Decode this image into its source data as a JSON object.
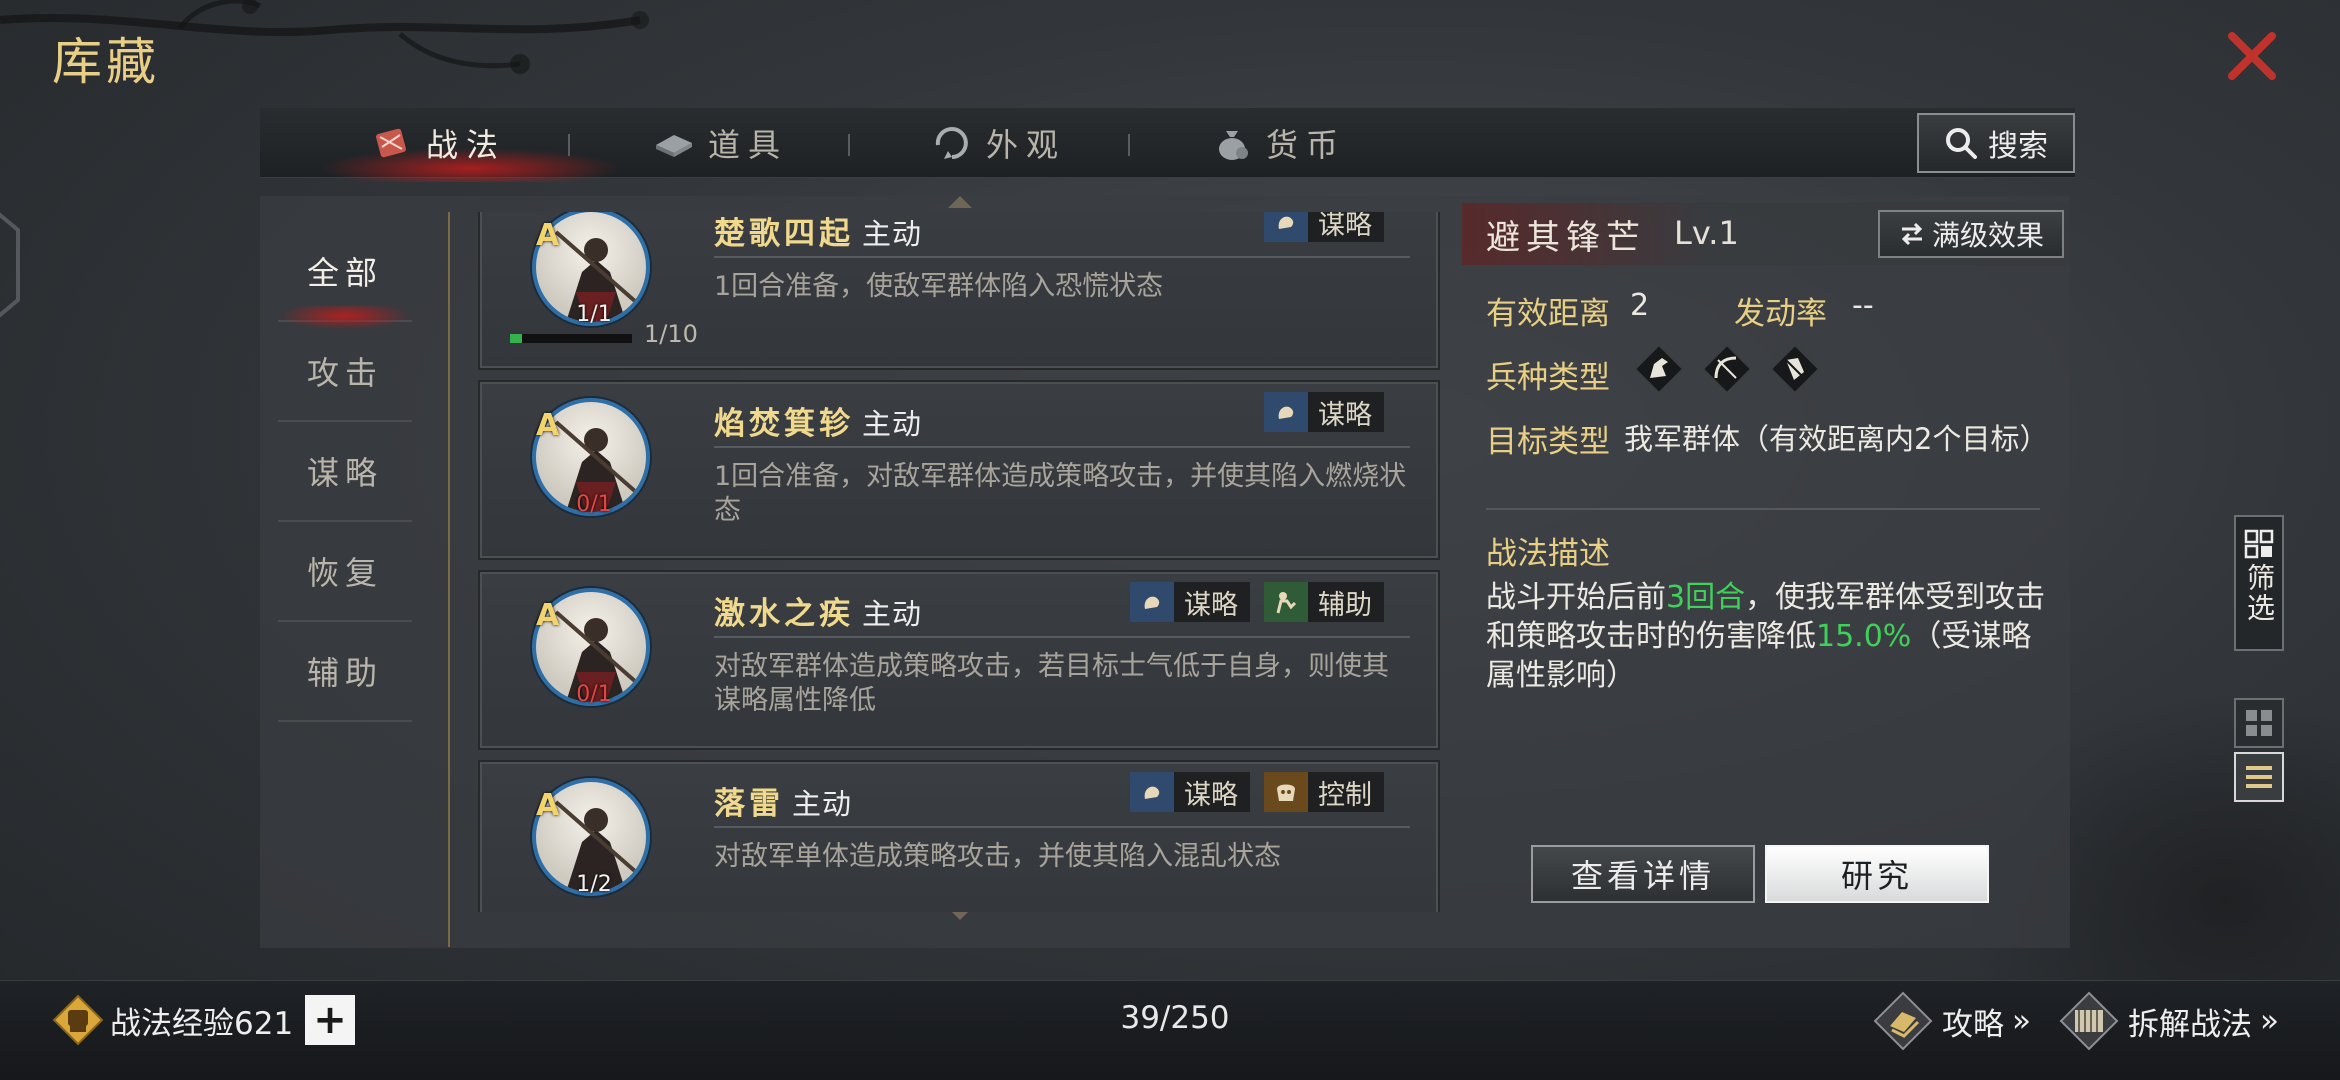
{
  "header": {
    "title": "库藏"
  },
  "tabs": [
    {
      "label": "战法",
      "icon": "scroll-icon",
      "active": true
    },
    {
      "label": "道具",
      "icon": "ingot-icon",
      "active": false
    },
    {
      "label": "外观",
      "icon": "swirl-icon",
      "active": false
    },
    {
      "label": "货币",
      "icon": "money-bag-icon",
      "active": false
    }
  ],
  "search": {
    "label": "搜索"
  },
  "categories": [
    {
      "label": "全部",
      "active": true
    },
    {
      "label": "攻击",
      "active": false
    },
    {
      "label": "谋略",
      "active": false
    },
    {
      "label": "恢复",
      "active": false
    },
    {
      "label": "辅助",
      "active": false
    }
  ],
  "skills": [
    {
      "name": "楚歌四起",
      "type": "主动",
      "rank": "A",
      "count": "1/1",
      "count_color": "white",
      "desc": "1回合准备，使敌军群体陷入恐慌状态",
      "tags": [
        {
          "label": "谋略",
          "icon": "strategy-icon"
        }
      ],
      "progress_label": "1/10",
      "progress": 0.1
    },
    {
      "name": "焰焚箕轸",
      "type": "主动",
      "rank": "A",
      "count": "0/1",
      "count_color": "red",
      "desc": "1回合准备，对敌军群体造成策略攻击，并使其陷入燃烧状态",
      "tags": [
        {
          "label": "谋略",
          "icon": "strategy-icon"
        }
      ]
    },
    {
      "name": "激水之疾",
      "type": "主动",
      "rank": "A",
      "count": "0/1",
      "count_color": "red",
      "desc": "对敌军群体造成策略攻击，若目标士气低于自身，则使其谋略属性降低",
      "tags": [
        {
          "label": "谋略",
          "icon": "strategy-icon"
        },
        {
          "label": "辅助",
          "icon": "support-icon"
        }
      ]
    },
    {
      "name": "落雷",
      "type": "主动",
      "rank": "A",
      "count": "1/2",
      "count_color": "white",
      "desc": "对敌军单体造成策略攻击，并使其陷入混乱状态",
      "tags": [
        {
          "label": "谋略",
          "icon": "strategy-icon"
        },
        {
          "label": "控制",
          "icon": "control-icon"
        }
      ]
    }
  ],
  "detail": {
    "name": "避其锋芒",
    "level": "Lv.1",
    "max_effect_label": "满级效果",
    "range_label": "有效距离",
    "range_value": "2",
    "rate_label": "发动率",
    "rate_value": "--",
    "troop_label": "兵种类型",
    "troop_icons": [
      "cavalry-icon",
      "archer-icon",
      "shield-icon"
    ],
    "target_label": "目标类型",
    "target_value": "我军群体（有效距离内2个目标）",
    "desc_title": "战法描述",
    "desc_parts": {
      "p1": "战斗开始后前",
      "hl1": "3回合",
      "p2": "，使我军群体受到攻击和策略攻击时的伤害降低",
      "hl2": "15.0%",
      "p3": "（受谋略属性影响）"
    },
    "view_detail_label": "查看详情",
    "research_label": "研究"
  },
  "sidebar_right": {
    "filter_label": "筛选",
    "grid_view_icon": "grid-view-icon",
    "list_view_icon": "list-view-icon"
  },
  "footer": {
    "exp_label": "战法经验621",
    "plus_label": "+",
    "page_count": "39/250",
    "guide_label": "攻略",
    "dismantle_label": "拆解战法",
    "more_glyph": "»"
  },
  "colors": {
    "accent_gold": "#e8cf84",
    "highlight_green": "#3fd15a",
    "close_red": "#c0322c",
    "count_red": "#e04848"
  }
}
